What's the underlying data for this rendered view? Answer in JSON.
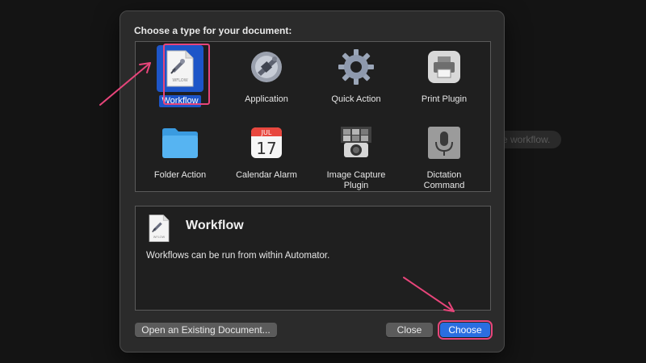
{
  "background": {
    "blurred_label": "e workflow."
  },
  "dialog": {
    "prompt": "Choose a type for your document:",
    "types": [
      {
        "label": "Workflow",
        "icon": "workflow-document-icon",
        "selected": true
      },
      {
        "label": "Application",
        "icon": "automator-robot-icon",
        "selected": false
      },
      {
        "label": "Quick Action",
        "icon": "gear-icon",
        "selected": false
      },
      {
        "label": "Print Plugin",
        "icon": "printer-icon",
        "selected": false
      },
      {
        "label": "Folder Action",
        "icon": "folder-icon",
        "selected": false
      },
      {
        "label": "Calendar Alarm",
        "icon": "calendar-icon",
        "selected": false,
        "calendar_month": "JUL",
        "calendar_day": "17"
      },
      {
        "label": "Image Capture Plugin",
        "icon": "camera-icon",
        "selected": false
      },
      {
        "label": "Dictation Command",
        "icon": "microphone-icon",
        "selected": false
      }
    ],
    "description": {
      "title": "Workflow",
      "text": "Workflows can be run from within Automator.",
      "icon_caption": "WFLOW"
    },
    "buttons": {
      "open_existing": "Open an Existing Document...",
      "close": "Close",
      "choose": "Choose"
    }
  },
  "colors": {
    "accent": "#2a6ee0",
    "selection": "#1d55c8",
    "annotation": "#e7457a"
  }
}
